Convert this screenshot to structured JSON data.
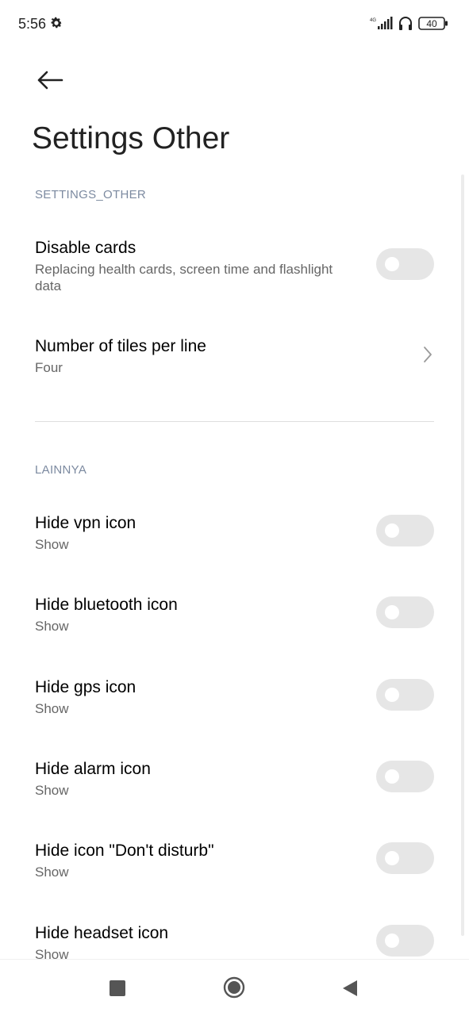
{
  "status_bar": {
    "time": "5:56",
    "network": "4G",
    "battery": "40",
    "icons": [
      "gear-icon",
      "signal-icon",
      "headset-icon",
      "battery-icon"
    ]
  },
  "header": {
    "back_icon": "arrow-left-icon",
    "title": "Settings Other"
  },
  "sections": [
    {
      "header": "SETTINGS_OTHER",
      "items": [
        {
          "title": "Disable cards",
          "summary": "Replacing health cards, screen time and flashlight data",
          "control": "toggle",
          "on": false
        },
        {
          "title": "Number of tiles per line",
          "summary": "Four",
          "control": "chevron"
        }
      ]
    },
    {
      "header": "LAINNYA",
      "items": [
        {
          "title": "Hide vpn icon",
          "summary": "Show",
          "control": "toggle",
          "on": false
        },
        {
          "title": "Hide bluetooth icon",
          "summary": "Show",
          "control": "toggle",
          "on": false
        },
        {
          "title": "Hide gps icon",
          "summary": "Show",
          "control": "toggle",
          "on": false
        },
        {
          "title": "Hide alarm icon",
          "summary": "Show",
          "control": "toggle",
          "on": false
        },
        {
          "title": "Hide icon \"Don't disturb\"",
          "summary": "Show",
          "control": "toggle",
          "on": false
        },
        {
          "title": "Hide headset icon",
          "summary": "Show",
          "control": "toggle",
          "on": false
        }
      ]
    }
  ],
  "nav_bar": {
    "icons": [
      "recents-square-icon",
      "home-circle-icon",
      "back-triangle-icon"
    ]
  },
  "colors": {
    "section_header": "#7c8aa0",
    "toggle_off": "#e6e6e6",
    "summary": "#666666"
  }
}
